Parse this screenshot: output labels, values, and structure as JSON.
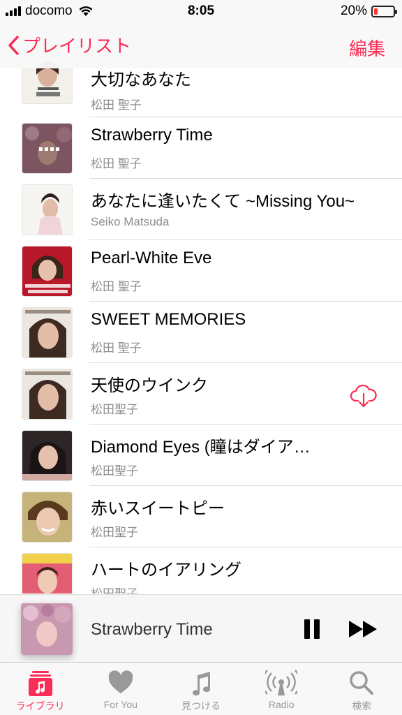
{
  "status": {
    "carrier": "docomo",
    "time": "8:05",
    "battery": "20%",
    "battery_level": 0.2
  },
  "nav": {
    "back_label": "プレイリスト",
    "edit_label": "編集"
  },
  "songs": [
    {
      "title": "大切なあなた",
      "artist": "松田 聖子"
    },
    {
      "title": "Strawberry Time",
      "artist": "松田 聖子"
    },
    {
      "title": "あなたに逢いたくて ~Missing You~",
      "artist": "Seiko Matsuda"
    },
    {
      "title": "Pearl-White Eve",
      "artist": "松田 聖子"
    },
    {
      "title": "SWEET MEMORIES",
      "artist": "松田 聖子"
    },
    {
      "title": "天使のウインク",
      "artist": "松田聖子"
    },
    {
      "title": "Diamond Eyes (瞳はダイア…",
      "artist": "松田聖子"
    },
    {
      "title": "赤いスイートピー",
      "artist": "松田聖子"
    },
    {
      "title": "ハートのイアリング",
      "artist": "松田聖子"
    }
  ],
  "now_playing": {
    "title": "Strawberry Time"
  },
  "tabs": [
    {
      "label": "ライブラリ"
    },
    {
      "label": "For You"
    },
    {
      "label": "見つける"
    },
    {
      "label": "Radio"
    },
    {
      "label": "検索"
    }
  ],
  "colors": {
    "accent": "#fb2c55",
    "battery_low": "#ff3b30"
  }
}
